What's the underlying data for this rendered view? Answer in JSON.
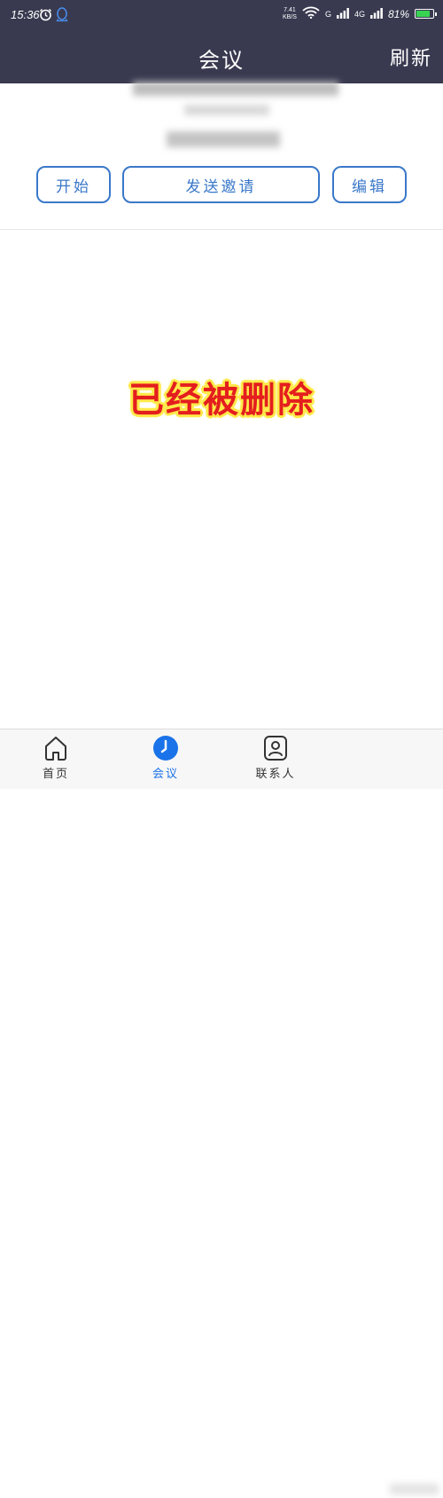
{
  "status_bar": {
    "time": "15:36",
    "net_speed_value": "7.41",
    "net_speed_unit": "KB/S",
    "signal1_label": "G",
    "signal2_label": "4G",
    "battery_text": "81%",
    "battery_level": 0.81,
    "battery_color": "#39d353"
  },
  "navbar": {
    "title": "会议",
    "refresh_label": "刷新",
    "bg_color": "#393a50"
  },
  "actions": {
    "start_label": "开始",
    "invite_label": "发送邀请",
    "edit_label": "编辑",
    "accent_color": "#3a78c9"
  },
  "overlay": {
    "text": "已经被删除"
  },
  "tabs": [
    {
      "label": "首页",
      "icon": "home-icon"
    },
    {
      "label": "会议",
      "icon": "clock-icon"
    },
    {
      "label": "联系人",
      "icon": "contact-icon"
    }
  ]
}
